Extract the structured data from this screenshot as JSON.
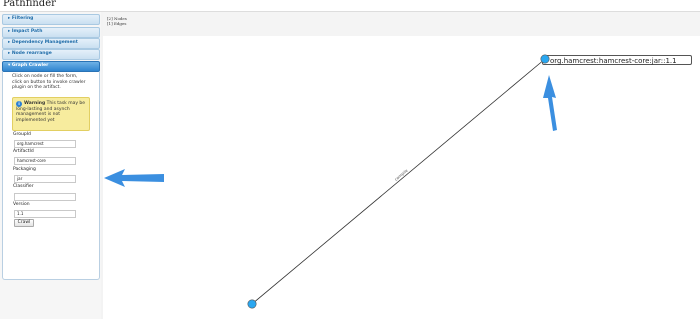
{
  "app": {
    "title": "Pathfinder"
  },
  "sidebar": {
    "sections": [
      {
        "label": "Filtering",
        "icon": "triangle-right-icon"
      },
      {
        "label": "Impact Path",
        "icon": "triangle-right-icon"
      },
      {
        "label": "Dependency Management",
        "icon": "triangle-right-icon"
      },
      {
        "label": "Node rearrange",
        "icon": "triangle-right-icon"
      },
      {
        "label": "Graph Crawler",
        "icon": "triangle-down-icon",
        "expanded": true
      }
    ],
    "crawler": {
      "intro": "Click on node or fill the form, click on button to invoke crawler plugin on the artifact.",
      "warning_title": "Warning",
      "warning_text": "This task may be long-lasting and asynch management is not implemented yet",
      "fields": [
        {
          "label": "GroupId",
          "value": "org.hamcrest"
        },
        {
          "label": "ArtifactId",
          "value": "hamcrest-core"
        },
        {
          "label": "Packaging",
          "value": "jar"
        },
        {
          "label": "Classifier",
          "value": ""
        },
        {
          "label": "Version",
          "value": "1.1"
        }
      ],
      "crawl_label": "Crawl"
    }
  },
  "graph": {
    "stats": {
      "nodes": "[2] Nodes",
      "edges": "[1] Edges"
    },
    "node_label": "org.hamcrest:hamcrest-core:jar::1.1",
    "edge_label": "compile",
    "node_color": "#2aa7f0"
  },
  "annotations": {
    "arrow_color": "#3b8fe0"
  }
}
